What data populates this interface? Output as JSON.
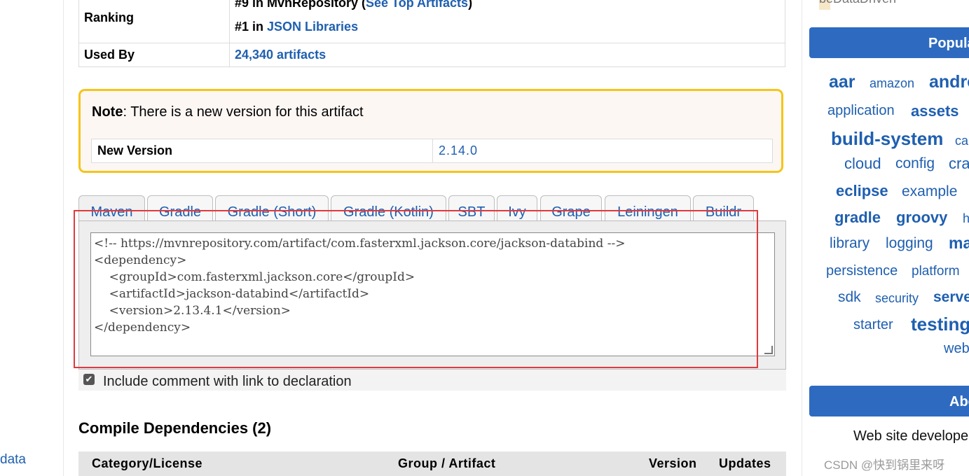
{
  "left": {
    "link_text": "data"
  },
  "info": {
    "ranking_label": "Ranking",
    "ranking_line1_prefix": "#9 in MvnRepository (",
    "ranking_line1_link": "See Top Artifacts",
    "ranking_line1_suffix": ")",
    "ranking_line2_prefix": "#1 in ",
    "ranking_line2_link": "JSON Libraries",
    "used_by_label": "Used By",
    "used_by_value": "24,340 artifacts"
  },
  "note": {
    "bold": "Note",
    "text": ": There is a new version for this artifact",
    "new_version_label": "New Version",
    "new_version_value": "2.14.0"
  },
  "tabs": [
    "Maven",
    "Gradle",
    "Gradle (Short)",
    "Gradle (Kotlin)",
    "SBT",
    "Ivy",
    "Grape",
    "Leiningen",
    "Buildr"
  ],
  "code": "<!-- https://mvnrepository.com/artifact/com.fasterxml.jackson.core/jackson-databind -->\n<dependency>\n    <groupId>com.fasterxml.jackson.core</groupId>\n    <artifactId>jackson-databind</artifactId>\n    <version>2.13.4.1</version>\n</dependency>",
  "checkbox": {
    "checked": true,
    "label": "Include comment with link to declaration"
  },
  "dependencies": {
    "title": "Compile Dependencies (2)",
    "headers": [
      "Category/License",
      "Group / Artifact",
      "Version",
      "Updates"
    ]
  },
  "sidebar": {
    "top_text": "beDataDriven",
    "popular_title": "Popular",
    "tags": [
      "aar",
      "amazon",
      "android",
      "application",
      "assets",
      "build-system",
      "ca",
      "cloud",
      "config",
      "cra",
      "eclipse",
      "example",
      "gradle",
      "groovy",
      "h",
      "library",
      "logging",
      "ma",
      "persistence",
      "platform",
      "sdk",
      "security",
      "serve",
      "starter",
      "testing",
      "web"
    ],
    "about_title": "About",
    "about_text": "Web site develope"
  },
  "watermark": "CSDN @快到锅里来呀"
}
